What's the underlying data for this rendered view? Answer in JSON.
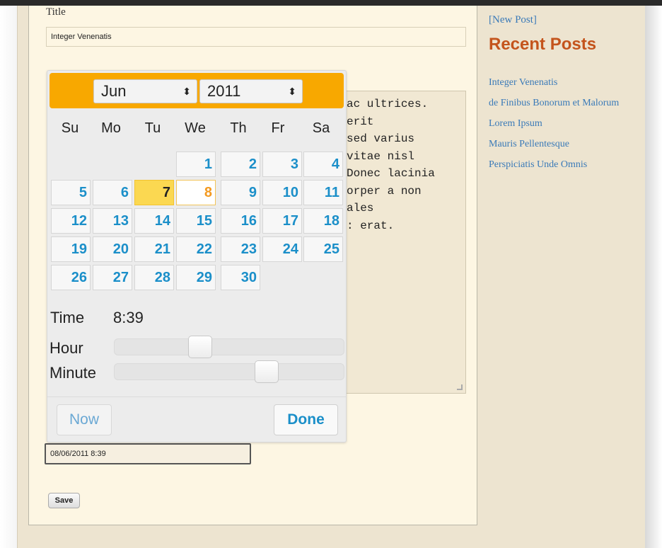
{
  "form": {
    "title_label": "Title",
    "title_value": "Integer Venenatis",
    "content_lines": [
      "ac ultrices.",
      "erit",
      "sed varius",
      "vitae nisl",
      "Donec lacinia",
      "orper a non",
      "ales",
      ": erat."
    ],
    "date_value": "08/06/2011 8:39",
    "save_label": "Save"
  },
  "sidebar": {
    "new_post": "[New Post]",
    "recent_title": "Recent Posts",
    "recent_posts": [
      "Integer Venenatis",
      "de Finibus Bonorum et Malorum",
      "Lorem Ipsum",
      "Mauris Pellentesque",
      "Perspiciatis Unde Omnis"
    ]
  },
  "datepicker": {
    "month": "Jun",
    "year": "2011",
    "weekdays": [
      "Su",
      "Mo",
      "Tu",
      "We",
      "Th",
      "Fr",
      "Sa"
    ],
    "first_weekday_index": 3,
    "days_in_month": 30,
    "today_day": 7,
    "selected_day": 8,
    "time_label": "Time",
    "time_value": "8:39",
    "hour_label": "Hour",
    "minute_label": "Minute",
    "hour_value": 8,
    "minute_value": 39,
    "now_label": "Now",
    "done_label": "Done"
  },
  "colors": {
    "header_accent": "#f8a800",
    "day_link": "#1b8fc9",
    "today_highlight": "#fbd851",
    "selected_text": "#f39a21",
    "sidebar_heading": "#c4541c",
    "sidebar_link": "#3a7ab8"
  },
  "icons": {
    "select_arrow": "updown-arrows-icon",
    "textarea_grip": "resize-grip-icon"
  }
}
